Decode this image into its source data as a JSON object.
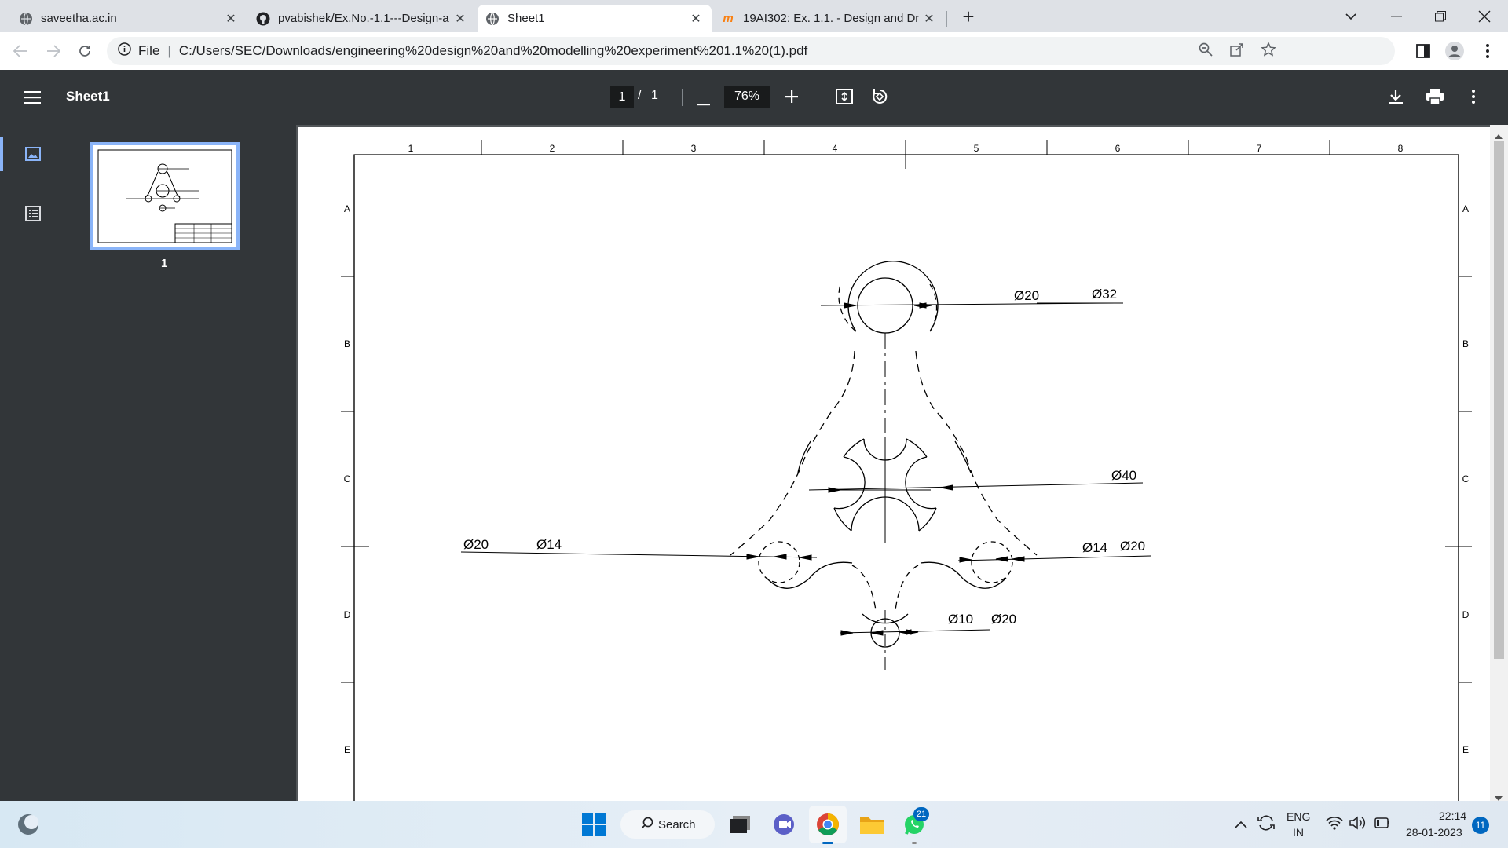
{
  "tabs": [
    {
      "title": "saveetha.ac.in",
      "active": false
    },
    {
      "title": "pvabishek/Ex.No.-1.1---Design-a",
      "active": false
    },
    {
      "title": "Sheet1",
      "active": true
    },
    {
      "title": "19AI302: Ex. 1.1. - Design and Dr",
      "active": false
    }
  ],
  "new_tab_glyph": "+",
  "address": {
    "scheme_label": "File",
    "url": "C:/Users/SEC/Downloads/engineering%20design%20and%20modelling%20experiment%201.1%20(1).pdf"
  },
  "pdf": {
    "doc_title": "Sheet1",
    "current_page": "1",
    "page_sep": "/",
    "total_pages": "1",
    "zoom": "76%"
  },
  "sidebar": {
    "thumbnail_page_label": "1"
  },
  "drawing": {
    "col_labels": [
      "1",
      "2",
      "3",
      "4",
      "5",
      "6",
      "7",
      "8"
    ],
    "row_labels": [
      "A",
      "B",
      "C",
      "D",
      "E"
    ],
    "dims": {
      "top_inner": "Ø20",
      "top_outer": "Ø32",
      "center": "Ø40",
      "left_outer": "Ø20",
      "left_inner": "Ø14",
      "right_inner": "Ø14",
      "right_outer": "Ø20",
      "bottom_inner": "Ø10",
      "bottom_outer": "Ø20"
    }
  },
  "taskbar": {
    "search_label": "Search",
    "whatsapp_badge": "21",
    "lang_top": "ENG",
    "lang_bottom": "IN",
    "time": "22:14",
    "date": "28-01-2023",
    "notification_count": "11"
  },
  "colors": {
    "active_accent": "#8ab4f8",
    "pdf_bar": "#323639",
    "content_bg": "#525659"
  }
}
